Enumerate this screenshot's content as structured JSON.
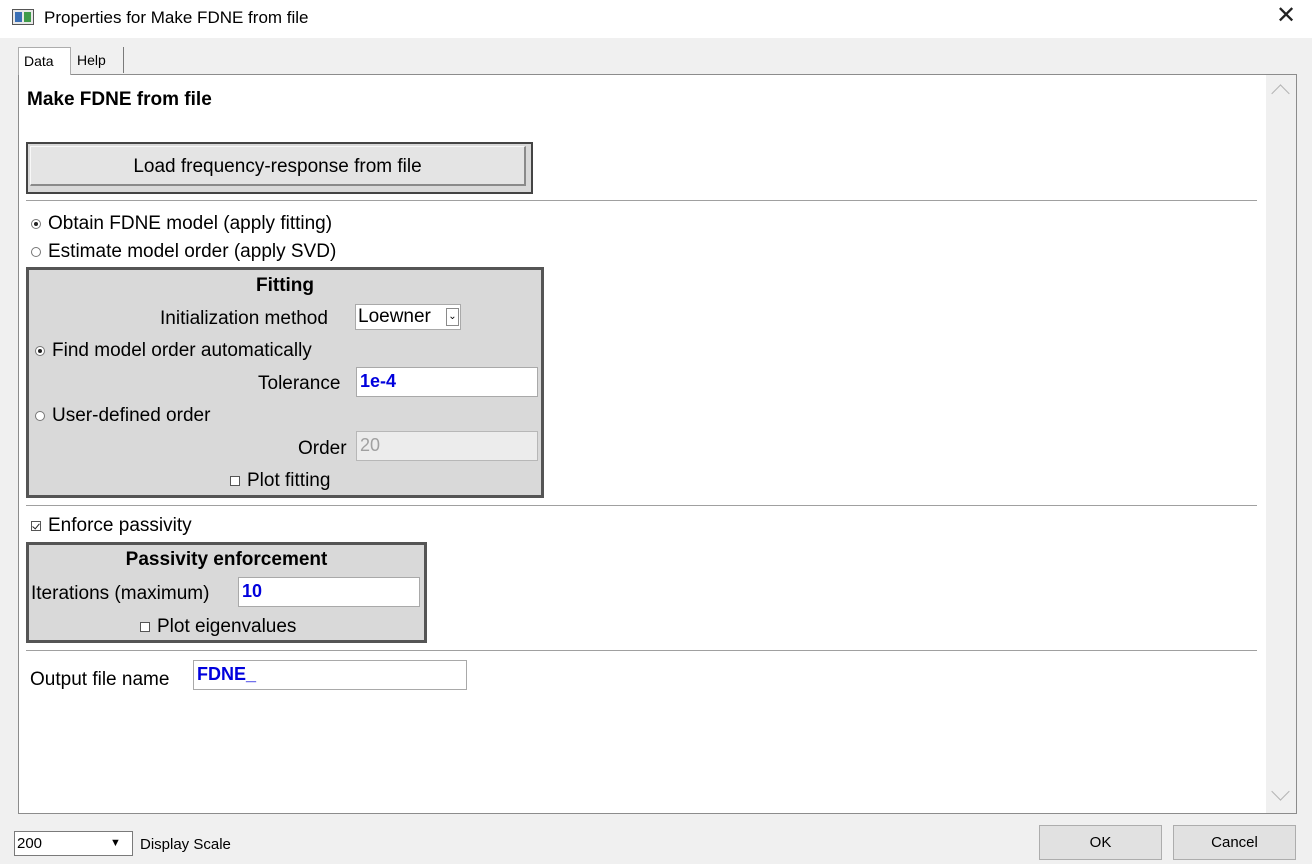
{
  "window": {
    "title": "Properties for Make FDNE from file"
  },
  "tabs": [
    {
      "label": "Data"
    },
    {
      "label": "Help"
    }
  ],
  "content": {
    "heading": "Make FDNE from file",
    "load_button": "Load frequency-response from file",
    "mode_options": [
      {
        "label": "Obtain FDNE model (apply fitting)",
        "selected": true
      },
      {
        "label": "Estimate model order (apply SVD)",
        "selected": false
      }
    ],
    "fitting": {
      "title": "Fitting",
      "init_method_label": "Initialization method",
      "init_method_value": "Loewner",
      "auto_order_label": "Find model order automatically",
      "auto_order_selected": true,
      "tolerance_label": "Tolerance",
      "tolerance_value": "1e-4",
      "user_order_label": "User-defined order",
      "user_order_selected": false,
      "order_label": "Order",
      "order_value": "20",
      "plot_fitting_label": "Plot fitting",
      "plot_fitting_checked": false
    },
    "enforce_passivity_label": "Enforce passivity",
    "enforce_passivity_checked": true,
    "passivity": {
      "title": "Passivity enforcement",
      "iterations_label": "Iterations (maximum)",
      "iterations_value": "10",
      "plot_eigen_label": "Plot eigenvalues",
      "plot_eigen_checked": false
    },
    "output_label": "Output file name",
    "output_value": "FDNE_"
  },
  "footer": {
    "display_scale_value": "200",
    "display_scale_label": "Display Scale",
    "ok_label": "OK",
    "cancel_label": "Cancel"
  }
}
